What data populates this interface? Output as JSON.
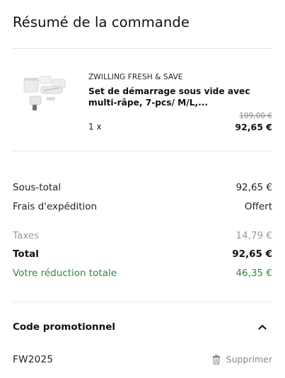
{
  "summary": {
    "title": "Résumé de la commande"
  },
  "product": {
    "brand": "ZWILLING FRESH & SAVE",
    "name": "Set de démarrage sous vide avec multi-râpe, 7-pcs/ M/L,...",
    "quantity": "1 x",
    "old_price": "109,00 €",
    "price": "92,65 €",
    "image_icon": "product-thumbnail"
  },
  "totals": {
    "subtotal_label": "Sous-total",
    "subtotal_value": "92,65 €",
    "shipping_label": "Frais d'expédition",
    "shipping_value": "Offert",
    "taxes_label": "Taxes",
    "taxes_value": "14,79 €",
    "total_label": "Total",
    "total_value": "92,65 €",
    "savings_label": "Votre réduction totale",
    "savings_value": "46,35 €"
  },
  "promo": {
    "title": "Code promotionnel",
    "code": "FW2025",
    "remove_label": "Supprimer",
    "toggle_icon": "chevron-up-icon",
    "remove_icon": "trash-icon"
  },
  "colors": {
    "savings": "#2e8b3a",
    "muted": "#9a9a9a",
    "divider": "#e4e4e4"
  }
}
